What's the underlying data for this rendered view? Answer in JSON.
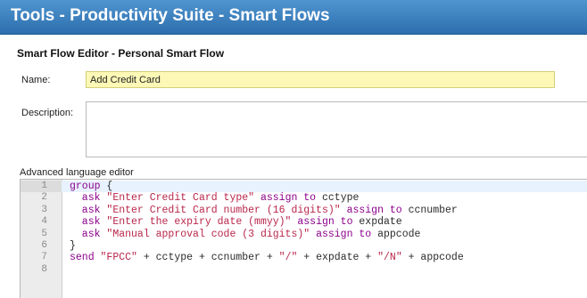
{
  "window": {
    "title": "Tools - Productivity Suite - Smart Flows"
  },
  "editor": {
    "heading": "Smart Flow Editor - Personal Smart Flow",
    "name_label": "Name:",
    "name_value": "Add Credit Card",
    "description_label": "Description:",
    "description_value": "",
    "advanced_label": "Advanced language editor"
  },
  "colors": {
    "titlebar": "#3a82c4",
    "name_field_bg": "#fdf8b6",
    "keyword": "#8b008b",
    "string": "#b8264a"
  },
  "code": {
    "active_line": 1,
    "lines": [
      {
        "num": "1",
        "tokens": [
          {
            "t": "group",
            "c": "kw"
          },
          {
            "t": " {",
            "c": ""
          }
        ]
      },
      {
        "num": "2",
        "tokens": [
          {
            "t": "  ask ",
            "c": "kw"
          },
          {
            "t": "\"Enter Credit Card type\"",
            "c": "str"
          },
          {
            "t": " assign to ",
            "c": "kw"
          },
          {
            "t": "cctype",
            "c": ""
          }
        ]
      },
      {
        "num": "3",
        "tokens": [
          {
            "t": "  ask ",
            "c": "kw"
          },
          {
            "t": "\"Enter Credit Card number (16 digits)\"",
            "c": "str"
          },
          {
            "t": " assign to ",
            "c": "kw"
          },
          {
            "t": "ccnumber",
            "c": ""
          }
        ]
      },
      {
        "num": "4",
        "tokens": [
          {
            "t": "  ask ",
            "c": "kw"
          },
          {
            "t": "\"Enter the expiry date (mmyy)\"",
            "c": "str"
          },
          {
            "t": " assign to ",
            "c": "kw"
          },
          {
            "t": "expdate",
            "c": ""
          }
        ]
      },
      {
        "num": "5",
        "tokens": [
          {
            "t": "  ask ",
            "c": "kw"
          },
          {
            "t": "\"Manual approval code (3 digits)\"",
            "c": "str"
          },
          {
            "t": " assign to ",
            "c": "kw"
          },
          {
            "t": "appcode",
            "c": ""
          }
        ]
      },
      {
        "num": "6",
        "tokens": [
          {
            "t": "}",
            "c": ""
          }
        ]
      },
      {
        "num": "7",
        "tokens": [
          {
            "t": "send ",
            "c": "kw"
          },
          {
            "t": "\"FPCC\"",
            "c": "str"
          },
          {
            "t": " + cctype + ccnumber + ",
            "c": ""
          },
          {
            "t": "\"/\"",
            "c": "str"
          },
          {
            "t": " + expdate + ",
            "c": ""
          },
          {
            "t": "\"/N\"",
            "c": "str"
          },
          {
            "t": " + appcode",
            "c": ""
          }
        ]
      },
      {
        "num": "8",
        "tokens": []
      }
    ]
  }
}
